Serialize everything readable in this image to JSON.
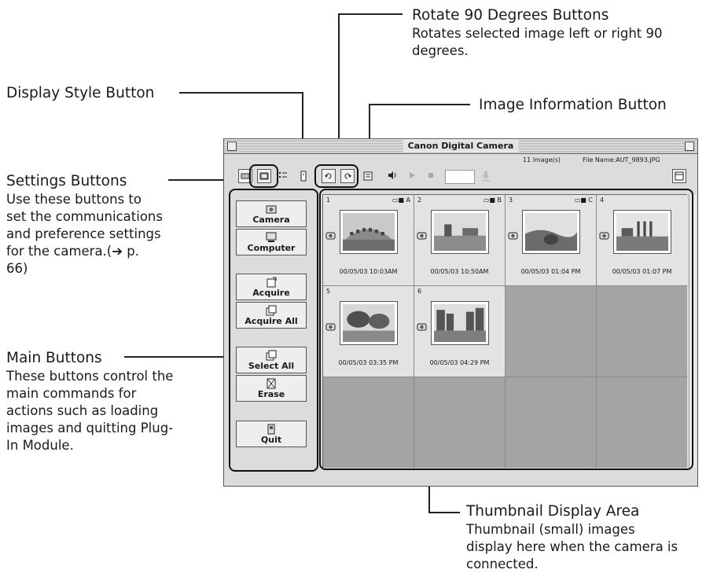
{
  "annotations": {
    "rotate": {
      "heading": "Rotate 90 Degrees Buttons",
      "desc": "Rotates selected image left or right 90 degrees."
    },
    "display_style": {
      "heading": "Display Style Button"
    },
    "image_info": {
      "heading": "Image Information Button"
    },
    "settings": {
      "heading": "Settings Buttons",
      "desc": "Use these buttons to set the communications and preference settings for the camera.(➔ p. 66)"
    },
    "main": {
      "heading": "Main Buttons",
      "desc": "These buttons control the main commands for actions such as loading images and quitting Plug-In Module."
    },
    "thumbnail": {
      "heading": "Thumbnail Display Area",
      "desc": "Thumbnail (small) images display here when the camera is connected."
    }
  },
  "window": {
    "title": "Canon Digital Camera",
    "image_count": "11 image(s)",
    "file_name": "File Name:AUT_9893.JPG"
  },
  "sidebar": {
    "camera": "Camera",
    "computer": "Computer",
    "acquire": "Acquire",
    "acquire_all": "Acquire All",
    "select_all": "Select All",
    "erase": "Erase",
    "quit": "Quit"
  },
  "thumbnails": [
    {
      "num": "1",
      "badge": "▭■ A",
      "date": "00/05/03 10:03AM",
      "scene": "colosseum"
    },
    {
      "num": "2",
      "badge": "▭■ B",
      "date": "00/05/03 10:50AM",
      "scene": "ruins"
    },
    {
      "num": "3",
      "badge": "▭■ C",
      "date": "00/05/03 01:04 PM",
      "scene": "hills"
    },
    {
      "num": "4",
      "badge": "",
      "date": "00/05/03 01:07 PM",
      "scene": "forum"
    },
    {
      "num": "5",
      "badge": "",
      "date": "00/05/03 03:35 PM",
      "scene": "trees"
    },
    {
      "num": "6",
      "badge": "",
      "date": "00/05/03 04:29 PM",
      "scene": "canal"
    }
  ],
  "icons": [
    "display-style-icon",
    "settings-list-icon",
    "rotate-left-icon",
    "rotate-right-icon",
    "image-info-icon",
    "speaker-icon",
    "play-icon",
    "stop-icon",
    "download-icon",
    "calendar-icon"
  ]
}
